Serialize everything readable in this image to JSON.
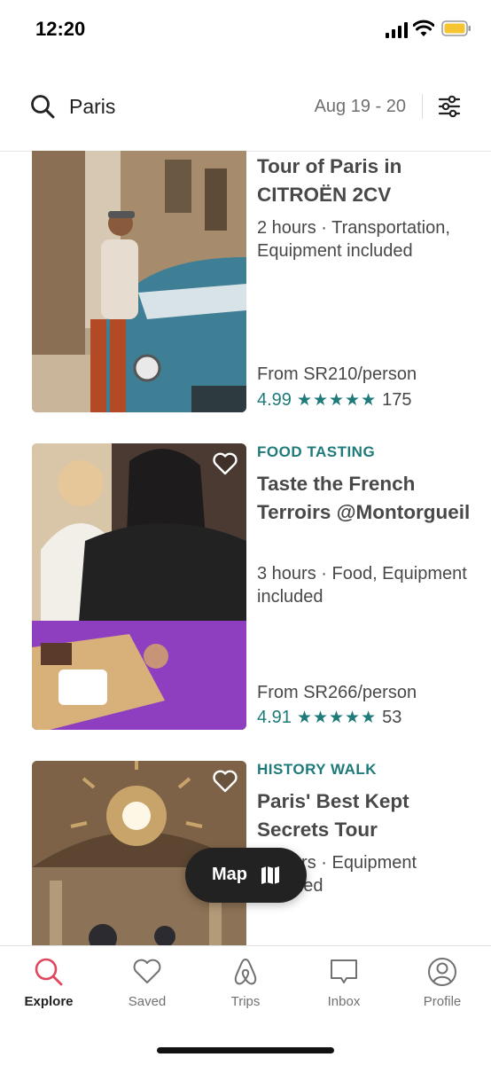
{
  "status_bar": {
    "time": "12:20"
  },
  "search": {
    "query": "Paris",
    "date_range": "Aug 19 - 20"
  },
  "listings": [
    {
      "category": "",
      "title": "Tour of Paris in CITROËN 2CV",
      "details": "2 hours · Transportation, Equipment included",
      "price": "From SR210/person",
      "rating": "4.99",
      "stars": "★★★★★",
      "review_count": "175"
    },
    {
      "category": "FOOD TASTING",
      "title": "Taste the French Terroirs @Montorgueil",
      "details": "3 hours · Food, Equipment included",
      "price": "From SR266/person",
      "rating": "4.91",
      "stars": "★★★★★",
      "review_count": "53"
    },
    {
      "category": "HISTORY WALK",
      "title": "Paris' Best Kept Secrets Tour",
      "details": "3 hours · Equipment included"
    }
  ],
  "map_button": {
    "label": "Map"
  },
  "bottom_nav": {
    "items": [
      {
        "label": "Explore",
        "icon": "search-icon",
        "active": true
      },
      {
        "label": "Saved",
        "icon": "heart-icon"
      },
      {
        "label": "Trips",
        "icon": "airbnb-logo-icon"
      },
      {
        "label": "Inbox",
        "icon": "message-icon"
      },
      {
        "label": "Profile",
        "icon": "profile-icon"
      }
    ]
  },
  "colors": {
    "accent_teal": "#1f7a7a",
    "active_nav": "#e0475c",
    "map_button": "#222222"
  }
}
